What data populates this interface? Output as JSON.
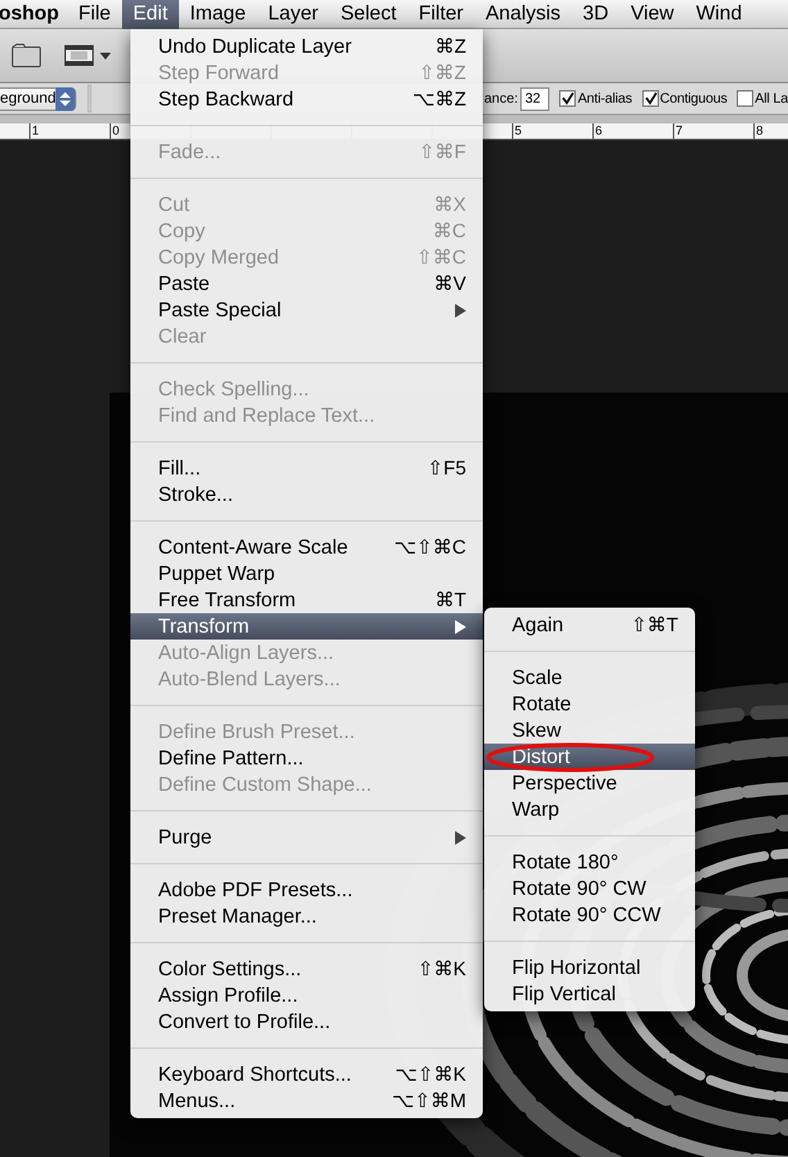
{
  "menubar": [
    {
      "label": "oshop",
      "kind": "app",
      "selected": false
    },
    {
      "label": "File",
      "kind": "menu",
      "selected": false
    },
    {
      "label": "Edit",
      "kind": "menu",
      "selected": true
    },
    {
      "label": "Image",
      "kind": "menu",
      "selected": false
    },
    {
      "label": "Layer",
      "kind": "menu",
      "selected": false
    },
    {
      "label": "Select",
      "kind": "menu",
      "selected": false
    },
    {
      "label": "Filter",
      "kind": "menu",
      "selected": false
    },
    {
      "label": "Analysis",
      "kind": "menu",
      "selected": false
    },
    {
      "label": "3D",
      "kind": "menu",
      "selected": false
    },
    {
      "label": "View",
      "kind": "menu",
      "selected": false
    },
    {
      "label": "Wind",
      "kind": "menu",
      "selected": false
    }
  ],
  "options_bar": {
    "dropdown": "eground",
    "tolerance_label": "ance:",
    "tolerance_value": "32",
    "checkboxes": [
      {
        "label": "Anti-alias",
        "checked": true
      },
      {
        "label": "Contiguous",
        "checked": true
      },
      {
        "label": "All La",
        "checked": false
      }
    ]
  },
  "ruler": {
    "labels": [
      "1",
      "0",
      "5",
      "6",
      "7",
      "8"
    ]
  },
  "edit_menu": [
    {
      "kind": "item",
      "label": "Undo Duplicate Layer",
      "shortcut": "⌘Z",
      "disabled": false,
      "selected": false,
      "submenu": false
    },
    {
      "kind": "item",
      "label": "Step Forward",
      "shortcut": "⇧⌘Z",
      "disabled": true,
      "selected": false,
      "submenu": false
    },
    {
      "kind": "item",
      "label": "Step Backward",
      "shortcut": "⌥⌘Z",
      "disabled": false,
      "selected": false,
      "submenu": false
    },
    {
      "kind": "separator"
    },
    {
      "kind": "item",
      "label": "Fade...",
      "shortcut": "⇧⌘F",
      "disabled": true,
      "selected": false,
      "submenu": false
    },
    {
      "kind": "separator"
    },
    {
      "kind": "item",
      "label": "Cut",
      "shortcut": "⌘X",
      "disabled": true,
      "selected": false,
      "submenu": false
    },
    {
      "kind": "item",
      "label": "Copy",
      "shortcut": "⌘C",
      "disabled": true,
      "selected": false,
      "submenu": false
    },
    {
      "kind": "item",
      "label": "Copy Merged",
      "shortcut": "⇧⌘C",
      "disabled": true,
      "selected": false,
      "submenu": false
    },
    {
      "kind": "item",
      "label": "Paste",
      "shortcut": "⌘V",
      "disabled": false,
      "selected": false,
      "submenu": false
    },
    {
      "kind": "item",
      "label": "Paste Special",
      "disabled": false,
      "selected": false,
      "submenu": true
    },
    {
      "kind": "item",
      "label": "Clear",
      "disabled": true,
      "selected": false,
      "submenu": false
    },
    {
      "kind": "separator"
    },
    {
      "kind": "item",
      "label": "Check Spelling...",
      "disabled": true,
      "selected": false,
      "submenu": false
    },
    {
      "kind": "item",
      "label": "Find and Replace Text...",
      "disabled": true,
      "selected": false,
      "submenu": false
    },
    {
      "kind": "separator"
    },
    {
      "kind": "item",
      "label": "Fill...",
      "shortcut": "⇧F5",
      "disabled": false,
      "selected": false,
      "submenu": false
    },
    {
      "kind": "item",
      "label": "Stroke...",
      "disabled": false,
      "selected": false,
      "submenu": false
    },
    {
      "kind": "separator"
    },
    {
      "kind": "item",
      "label": "Content-Aware Scale",
      "shortcut": "⌥⇧⌘C",
      "disabled": false,
      "selected": false,
      "submenu": false
    },
    {
      "kind": "item",
      "label": "Puppet Warp",
      "disabled": false,
      "selected": false,
      "submenu": false
    },
    {
      "kind": "item",
      "label": "Free Transform",
      "shortcut": "⌘T",
      "disabled": false,
      "selected": false,
      "submenu": false
    },
    {
      "kind": "item",
      "label": "Transform",
      "disabled": false,
      "selected": true,
      "submenu": true
    },
    {
      "kind": "item",
      "label": "Auto-Align Layers...",
      "disabled": true,
      "selected": false,
      "submenu": false
    },
    {
      "kind": "item",
      "label": "Auto-Blend Layers...",
      "disabled": true,
      "selected": false,
      "submenu": false
    },
    {
      "kind": "separator"
    },
    {
      "kind": "item",
      "label": "Define Brush Preset...",
      "disabled": true,
      "selected": false,
      "submenu": false
    },
    {
      "kind": "item",
      "label": "Define Pattern...",
      "disabled": false,
      "selected": false,
      "submenu": false
    },
    {
      "kind": "item",
      "label": "Define Custom Shape...",
      "disabled": true,
      "selected": false,
      "submenu": false
    },
    {
      "kind": "separator"
    },
    {
      "kind": "item",
      "label": "Purge",
      "disabled": false,
      "selected": false,
      "submenu": true
    },
    {
      "kind": "separator"
    },
    {
      "kind": "item",
      "label": "Adobe PDF Presets...",
      "disabled": false,
      "selected": false,
      "submenu": false
    },
    {
      "kind": "item",
      "label": "Preset Manager...",
      "disabled": false,
      "selected": false,
      "submenu": false
    },
    {
      "kind": "separator"
    },
    {
      "kind": "item",
      "label": "Color Settings...",
      "shortcut": "⇧⌘K",
      "disabled": false,
      "selected": false,
      "submenu": false
    },
    {
      "kind": "item",
      "label": "Assign Profile...",
      "disabled": false,
      "selected": false,
      "submenu": false
    },
    {
      "kind": "item",
      "label": "Convert to Profile...",
      "disabled": false,
      "selected": false,
      "submenu": false
    },
    {
      "kind": "separator"
    },
    {
      "kind": "item",
      "label": "Keyboard Shortcuts...",
      "shortcut": "⌥⇧⌘K",
      "disabled": false,
      "selected": false,
      "submenu": false
    },
    {
      "kind": "item",
      "label": "Menus...",
      "shortcut": "⌥⇧⌘M",
      "disabled": false,
      "selected": false,
      "submenu": false
    }
  ],
  "transform_submenu": [
    {
      "kind": "item",
      "label": "Again",
      "shortcut": "⇧⌘T",
      "disabled": false,
      "selected": false,
      "submenu": false
    },
    {
      "kind": "separator"
    },
    {
      "kind": "item",
      "label": "Scale",
      "disabled": false,
      "selected": false,
      "submenu": false
    },
    {
      "kind": "item",
      "label": "Rotate",
      "disabled": false,
      "selected": false,
      "submenu": false
    },
    {
      "kind": "item",
      "label": "Skew",
      "disabled": false,
      "selected": false,
      "submenu": false
    },
    {
      "kind": "item",
      "label": "Distort",
      "disabled": false,
      "selected": true,
      "submenu": false
    },
    {
      "kind": "item",
      "label": "Perspective",
      "disabled": false,
      "selected": false,
      "submenu": false
    },
    {
      "kind": "item",
      "label": "Warp",
      "disabled": false,
      "selected": false,
      "submenu": false
    },
    {
      "kind": "separator"
    },
    {
      "kind": "item",
      "label": "Rotate 180°",
      "disabled": false,
      "selected": false,
      "submenu": false
    },
    {
      "kind": "item",
      "label": "Rotate 90° CW",
      "disabled": false,
      "selected": false,
      "submenu": false
    },
    {
      "kind": "item",
      "label": "Rotate 90° CCW",
      "disabled": false,
      "selected": false,
      "submenu": false
    },
    {
      "kind": "separator"
    },
    {
      "kind": "item",
      "label": "Flip Horizontal",
      "disabled": false,
      "selected": false,
      "submenu": false
    },
    {
      "kind": "item",
      "label": "Flip Vertical",
      "disabled": false,
      "selected": false,
      "submenu": false
    }
  ]
}
